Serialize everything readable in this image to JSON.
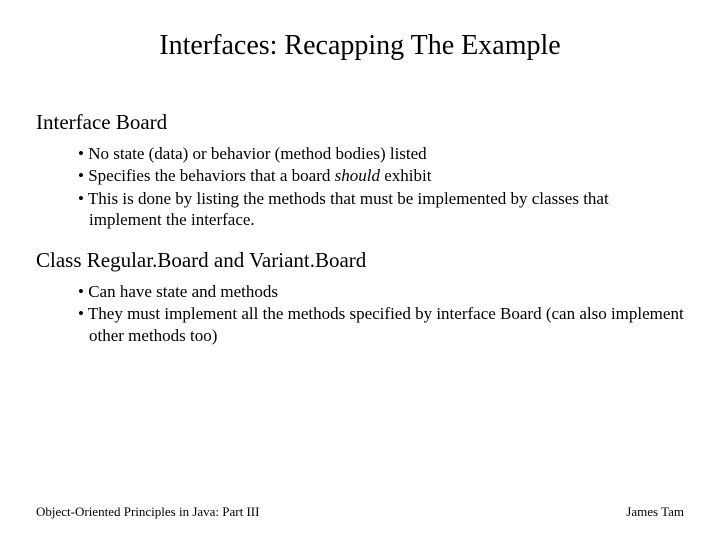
{
  "title": "Interfaces: Recapping The Example",
  "sections": [
    {
      "heading": "Interface Board",
      "bullets": [
        {
          "pre": "No state (data) or behavior (method bodies) listed",
          "em": "",
          "post": ""
        },
        {
          "pre": "Specifies the behaviors that a board ",
          "em": "should",
          "post": " exhibit"
        },
        {
          "pre": "This is done by listing the methods that must be implemented by classes that implement the interface.",
          "em": "",
          "post": ""
        }
      ]
    },
    {
      "heading": "Class Regular.Board and Variant.Board",
      "bullets": [
        {
          "pre": "Can have state and methods",
          "em": "",
          "post": ""
        },
        {
          "pre": "They must implement all the methods specified by interface Board (can also implement other methods too)",
          "em": "",
          "post": ""
        }
      ]
    }
  ],
  "footer": {
    "left": "Object-Oriented Principles in Java: Part III",
    "right": "James Tam"
  },
  "bullet_char": "• "
}
